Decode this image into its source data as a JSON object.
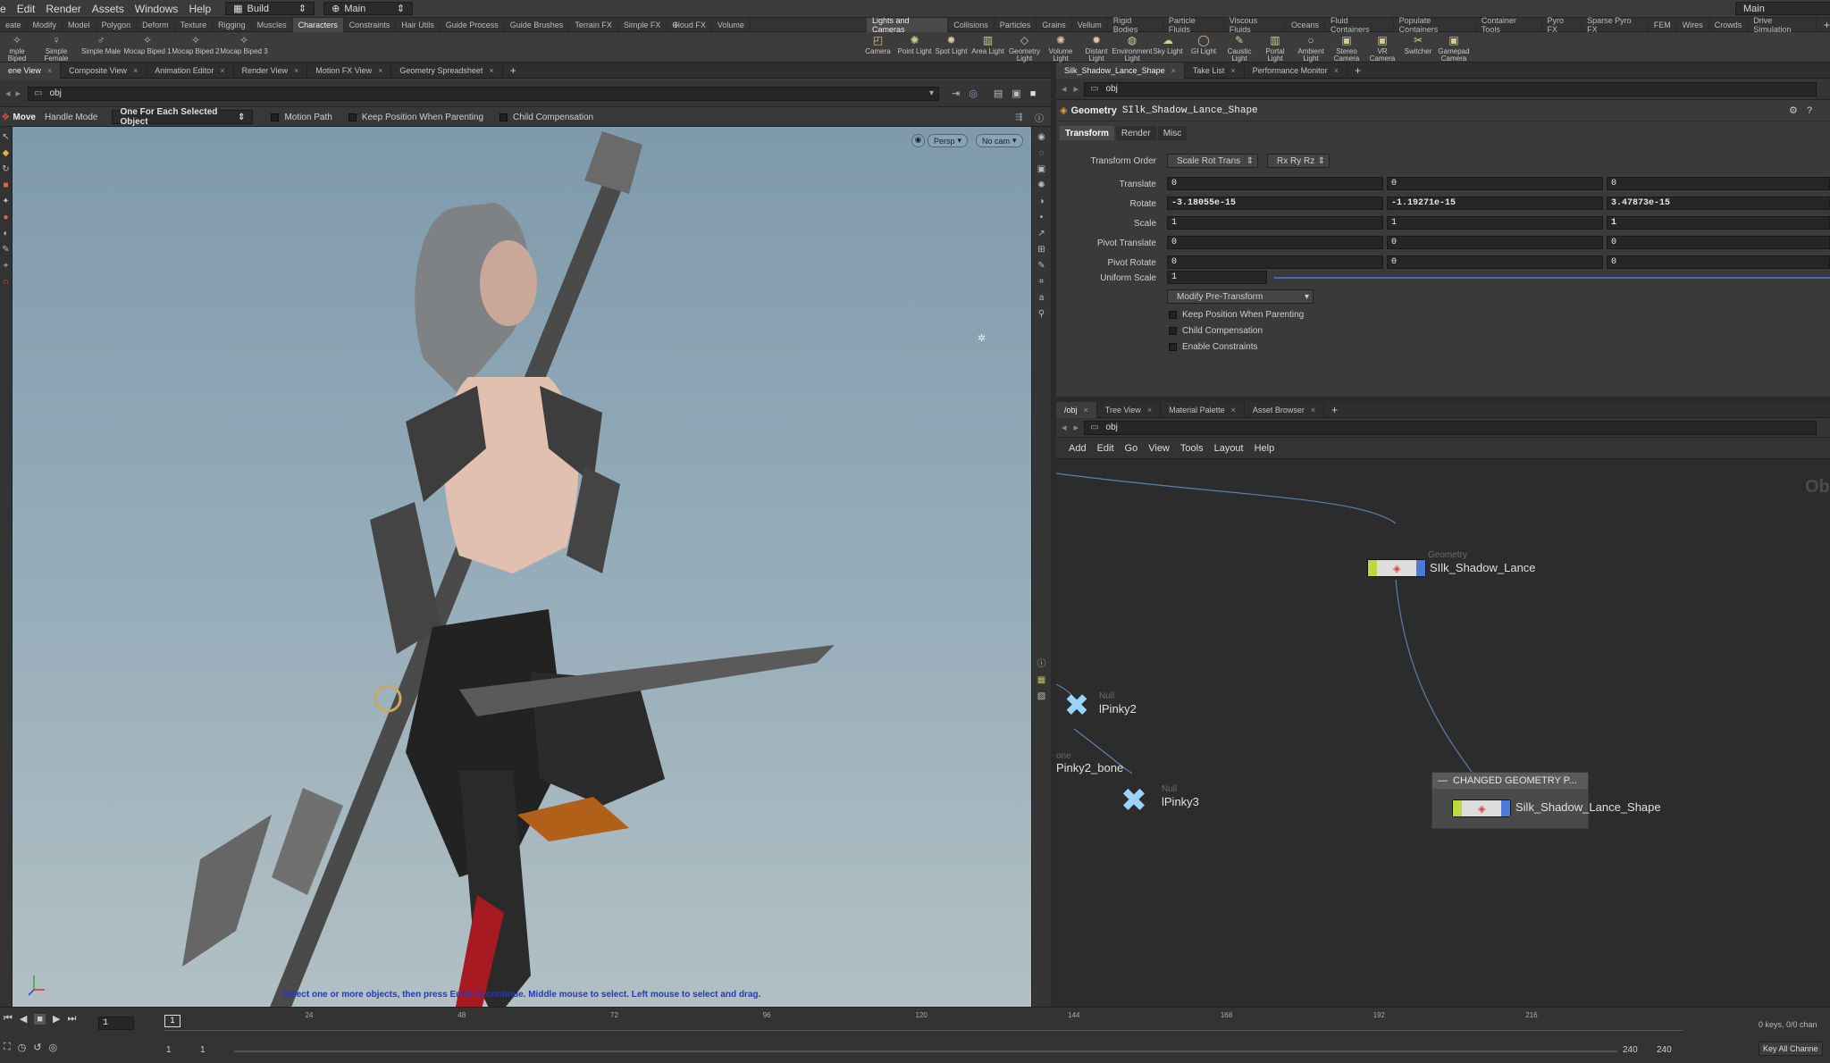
{
  "menubar": {
    "items": [
      "e",
      "Edit",
      "Render",
      "Assets",
      "Windows",
      "Help"
    ],
    "desktop": "Build",
    "context": "Main",
    "right_title": "Main"
  },
  "shelf_tabs_left": [
    "eate",
    "Modify",
    "Model",
    "Polygon",
    "Deform",
    "Texture",
    "Rigging",
    "Muscles",
    "Characters",
    "Constraints",
    "Hair Utils",
    "Guide Process",
    "Guide Brushes",
    "Terrain FX",
    "Simple FX",
    "Cloud FX",
    "Volume"
  ],
  "shelf_tabs_right": [
    "Lights and Cameras",
    "Collisions",
    "Particles",
    "Grains",
    "Vellum",
    "Rigid Bodies",
    "Particle Fluids",
    "Viscous Fluids",
    "Oceans",
    "Fluid Containers",
    "Populate Containers",
    "Container Tools",
    "Pyro FX",
    "Sparse Pyro FX",
    "FEM",
    "Wires",
    "Crowds",
    "Drive Simulation"
  ],
  "shelf_tools_left": [
    "mple Biped",
    "Simple Female",
    "Simple Male",
    "Mocap Biped 1",
    "Mocap Biped 2",
    "Mocap Biped 3"
  ],
  "shelf_tools_right": [
    "Camera",
    "Point Light",
    "Spot Light",
    "Area Light",
    "Geometry Light",
    "Volume Light",
    "Distant Light",
    "Environment Light",
    "Sky Light",
    "GI Light",
    "Caustic Light",
    "Portal Light",
    "Ambient Light",
    "Stereo Camera",
    "VR Camera",
    "Switcher",
    "Gamepad Camera"
  ],
  "left_pane_tabs": [
    "ene View",
    "Composite View",
    "Animation Editor",
    "Render View",
    "Motion FX View",
    "Geometry Spreadsheet"
  ],
  "viewport": {
    "path": "obj",
    "tool_name": "Move",
    "handle_mode": "Handle Mode",
    "select_mode": "One For Each Selected Object",
    "options": [
      "Motion Path",
      "Keep Position When Parenting",
      "Child Compensation"
    ],
    "persp": "Persp",
    "cam": "No cam",
    "status": "Select one or more objects, then press Enter to continue. Middle mouse to select. Left mouse to select and drag."
  },
  "right_pane_tabs": [
    "Silk_Shadow_Lance_Shape",
    "Take List",
    "Performance Monitor"
  ],
  "params": {
    "path": "obj",
    "node_type": "Geometry",
    "node_name": "SIlk_Shadow_Lance_Shape",
    "tabs": [
      "Transform",
      "Render",
      "Misc"
    ],
    "transform_order_label": "Transform Order",
    "transform_order": "Scale Rot Trans",
    "rot_order": "Rx Ry Rz",
    "rows": [
      {
        "label": "Translate",
        "v": [
          "0",
          "0",
          "0"
        ]
      },
      {
        "label": "Rotate",
        "v": [
          "-3.18055e-15",
          "-1.19271e-15",
          "3.47873e-15"
        ]
      },
      {
        "label": "Scale",
        "v": [
          "1",
          "1",
          "1"
        ]
      },
      {
        "label": "Pivot Translate",
        "v": [
          "0",
          "0",
          "0"
        ]
      },
      {
        "label": "Pivot Rotate",
        "v": [
          "0",
          "0",
          "0"
        ]
      }
    ],
    "uniform_scale_label": "Uniform Scale",
    "uniform_scale": "1",
    "pre_transform": "Modify Pre-Transform",
    "checks": [
      "Keep Position When Parenting",
      "Child Compensation",
      "Enable Constraints"
    ]
  },
  "network": {
    "tabs": [
      "/obj",
      "Tree View",
      "Material Palette",
      "Asset Browser"
    ],
    "path": "obj",
    "menu": [
      "Add",
      "Edit",
      "Go",
      "View",
      "Tools",
      "Layout",
      "Help"
    ],
    "watermark": "Ob",
    "nodes": [
      {
        "type": "Geometry",
        "name": "SIlk_Shadow_Lance"
      },
      {
        "type": "Null",
        "name": "lPinky2"
      },
      {
        "type": "one",
        "name": "Pinky2_bone"
      },
      {
        "type": "Null",
        "name": "lPinky3"
      },
      {
        "type": "",
        "name": "Silk_Shadow_Lance_Shape"
      }
    ],
    "netbox_title": "CHANGED GEOMETRY P..."
  },
  "timeline": {
    "frame": "1",
    "ticks": [
      "24",
      "48",
      "72",
      "96",
      "120",
      "144",
      "168",
      "192",
      "216"
    ],
    "range_start": "1",
    "range_start2": "1",
    "end": "240",
    "end2": "240",
    "keys": "0 keys, 0/0 chan",
    "key_all": "Key All Channe"
  }
}
